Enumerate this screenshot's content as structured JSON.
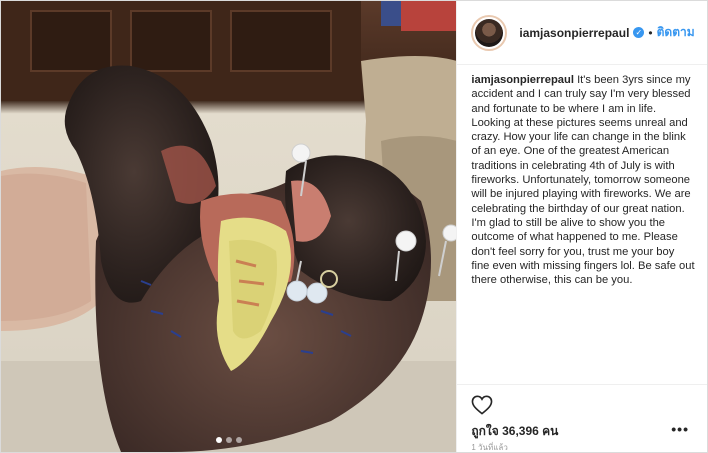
{
  "post": {
    "username": "iamjasonpierrepaul",
    "verified": true,
    "separator": "•",
    "follow_label": "ติดตาม",
    "caption_user": "iamjasonpierrepaul",
    "caption_text": "It's been 3yrs since my accident and I can truly say I'm very blessed and fortunate to be where I am in life. Looking at these pictures seems unreal and crazy. How your life can change in the blink of an eye. One of the greatest American traditions in celebrating 4th of July is with fireworks. Unfortunately, tomorrow someone will be injured playing with fireworks. We are celebrating the birthday of our great nation. I'm glad to still be alive to show you the outcome of what happened to me. Please don't feel sorry for you, trust me your boy fine even with missing fingers lol. Be safe out there otherwise, this can be you.",
    "likes_label": "ถูกใจ 36,396 คน",
    "more_label": "•••",
    "timestamp": "1 วันที่แล้ว"
  },
  "media": {
    "carousel_count": 3,
    "carousel_active": 1
  },
  "icons": {
    "verified": "verified-badge-icon",
    "like": "heart-icon",
    "more": "more-options-icon"
  },
  "colors": {
    "link_blue": "#3897f0",
    "text": "#262626",
    "muted": "#999999",
    "border": "#efefef"
  }
}
